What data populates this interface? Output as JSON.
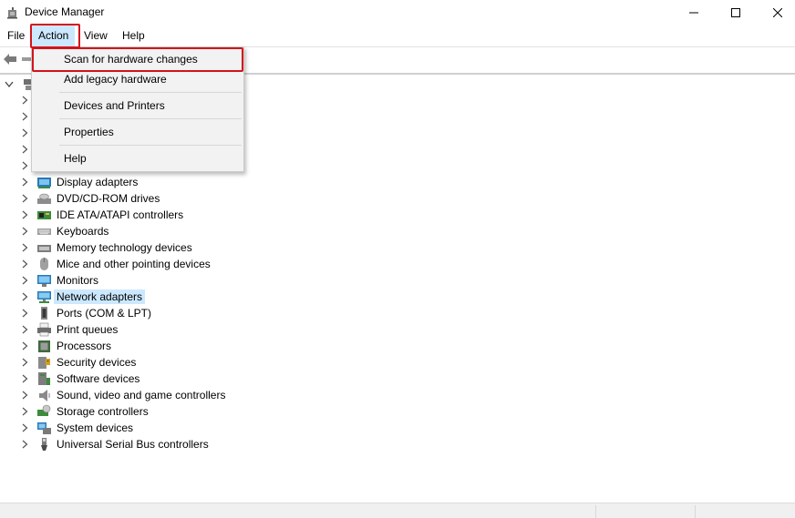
{
  "window": {
    "title": "Device Manager"
  },
  "menubar": {
    "items": [
      "File",
      "Action",
      "View",
      "Help"
    ]
  },
  "action_menu": {
    "items": [
      "Scan for hardware changes",
      "Add legacy hardware",
      "Devices and Printers",
      "Properties",
      "Help"
    ]
  },
  "tree": {
    "categories": [
      {
        "label": "Display adapters",
        "icon": "display-adapter-icon"
      },
      {
        "label": "DVD/CD-ROM drives",
        "icon": "dvd-drive-icon"
      },
      {
        "label": "IDE ATA/ATAPI controllers",
        "icon": "ide-controller-icon"
      },
      {
        "label": "Keyboards",
        "icon": "keyboard-icon"
      },
      {
        "label": "Memory technology devices",
        "icon": "memory-device-icon"
      },
      {
        "label": "Mice and other pointing devices",
        "icon": "mouse-icon"
      },
      {
        "label": "Monitors",
        "icon": "monitor-icon"
      },
      {
        "label": "Network adapters",
        "icon": "network-adapter-icon",
        "selected": true
      },
      {
        "label": "Ports (COM & LPT)",
        "icon": "port-icon"
      },
      {
        "label": "Print queues",
        "icon": "printer-icon"
      },
      {
        "label": "Processors",
        "icon": "processor-icon"
      },
      {
        "label": "Security devices",
        "icon": "security-device-icon"
      },
      {
        "label": "Software devices",
        "icon": "software-device-icon"
      },
      {
        "label": "Sound, video and game controllers",
        "icon": "speaker-icon"
      },
      {
        "label": "Storage controllers",
        "icon": "storage-controller-icon"
      },
      {
        "label": "System devices",
        "icon": "system-device-icon"
      },
      {
        "label": "Universal Serial Bus controllers",
        "icon": "usb-icon"
      }
    ]
  },
  "colors": {
    "highlight_border": "#d4131b",
    "selection": "#cce8ff",
    "menu_background": "#f2f2f2"
  }
}
